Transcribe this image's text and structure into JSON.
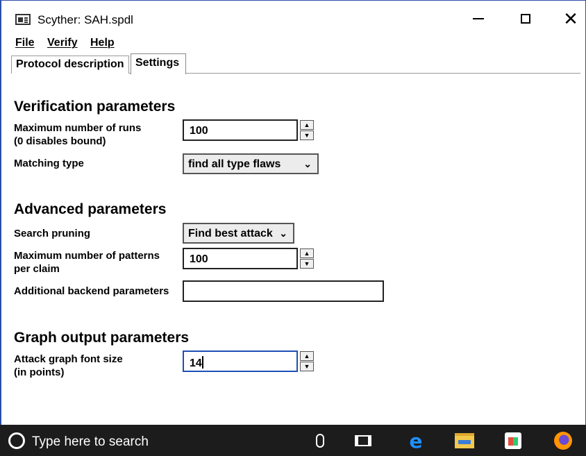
{
  "window": {
    "title": "Scyther: SAH.spdl"
  },
  "menu": [
    "File",
    "Verify",
    "Help"
  ],
  "tabs": [
    {
      "label": "Protocol description",
      "active": false
    },
    {
      "label": "Settings",
      "active": true
    }
  ],
  "verification": {
    "title": "Verification parameters",
    "max_runs": {
      "label_line1": "Maximum number of runs",
      "label_line2": "(0 disables bound)",
      "value": "100"
    },
    "matching": {
      "label": "Matching type",
      "value": "find all type flaws"
    }
  },
  "advanced": {
    "title": "Advanced parameters",
    "pruning": {
      "label": "Search pruning",
      "value": "Find best attack"
    },
    "max_patterns": {
      "label_line1": "Maximum number of patterns",
      "label_line2": "per claim",
      "value": "100"
    },
    "backend": {
      "label": "Additional backend parameters",
      "value": ""
    }
  },
  "graph": {
    "title": "Graph output parameters",
    "font_size": {
      "label_line1": "Attack graph font size",
      "label_line2": "(in points)",
      "value": "14"
    }
  },
  "taskbar": {
    "search_placeholder": "Type here to search",
    "icons": [
      "microphone-icon",
      "task-view-icon",
      "edge-icon",
      "file-explorer-icon",
      "store-icon",
      "firefox-icon"
    ]
  },
  "colors": {
    "window_border": "#2b4fa8",
    "taskbar": "#1c1c1c",
    "focus_border": "#1f4fb5"
  }
}
